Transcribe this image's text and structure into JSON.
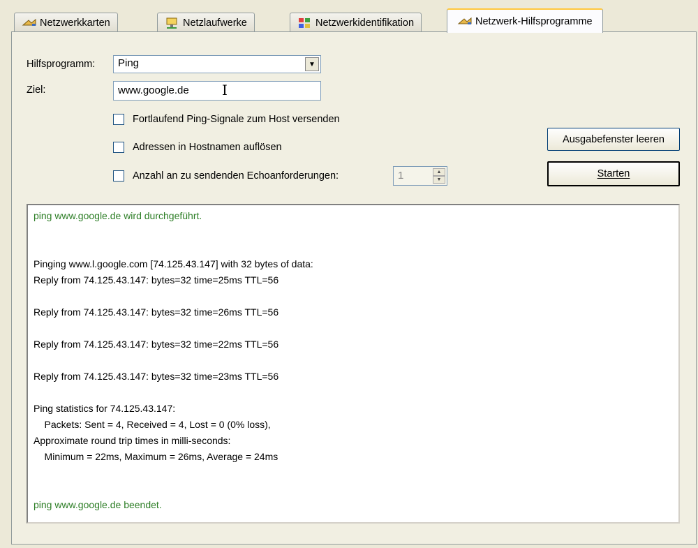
{
  "tabs": [
    {
      "label": "Netzwerkkarten",
      "icon": "network-cards-icon"
    },
    {
      "label": "Netzlaufwerke",
      "icon": "network-drives-icon"
    },
    {
      "label": "Netzwerkidentifikation",
      "icon": "network-identification-icon"
    },
    {
      "label": "Netzwerk-Hilfsprogramme",
      "icon": "network-tools-icon",
      "active": true
    }
  ],
  "form": {
    "tool_label": "Hilfsprogramm:",
    "tool_value": "Ping",
    "target_label": "Ziel:",
    "target_value": "www.google.de",
    "opt_continuous": "Fortlaufend Ping-Signale zum Host versenden",
    "opt_resolve": "Adressen in Hostnamen auflösen",
    "opt_count": "Anzahl an zu sendenden Echoanforderungen:",
    "count_value": "1"
  },
  "buttons": {
    "clear": "Ausgabefenster leeren",
    "start": "Starten"
  },
  "output": {
    "lines": [
      {
        "text": "ping www.google.de wird durchgeführt.",
        "color": "green"
      },
      {
        "text": "",
        "color": "black"
      },
      {
        "text": "",
        "color": "black"
      },
      {
        "text": "Pinging www.l.google.com [74.125.43.147] with 32 bytes of data:",
        "color": "black"
      },
      {
        "text": "Reply from 74.125.43.147: bytes=32 time=25ms TTL=56",
        "color": "black"
      },
      {
        "text": "",
        "color": "black"
      },
      {
        "text": "Reply from 74.125.43.147: bytes=32 time=26ms TTL=56",
        "color": "black"
      },
      {
        "text": "",
        "color": "black"
      },
      {
        "text": "Reply from 74.125.43.147: bytes=32 time=22ms TTL=56",
        "color": "black"
      },
      {
        "text": "",
        "color": "black"
      },
      {
        "text": "Reply from 74.125.43.147: bytes=32 time=23ms TTL=56",
        "color": "black"
      },
      {
        "text": "",
        "color": "black"
      },
      {
        "text": "Ping statistics for 74.125.43.147:",
        "color": "black"
      },
      {
        "text": "    Packets: Sent = 4, Received = 4, Lost = 0 (0% loss),",
        "color": "black"
      },
      {
        "text": "Approximate round trip times in milli-seconds:",
        "color": "black"
      },
      {
        "text": "    Minimum = 22ms, Maximum = 26ms, Average = 24ms",
        "color": "black"
      },
      {
        "text": "",
        "color": "black"
      },
      {
        "text": "",
        "color": "black"
      },
      {
        "text": "ping www.google.de beendet.",
        "color": "green"
      }
    ]
  },
  "colors": {
    "output_green": "#2d7e26",
    "tab_active_accent": "#ffc73c"
  }
}
